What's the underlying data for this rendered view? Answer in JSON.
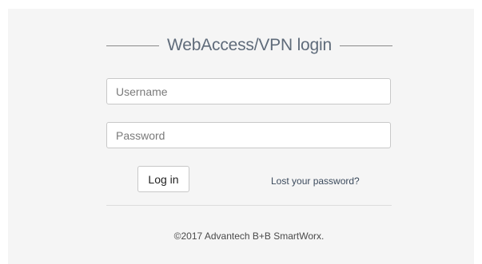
{
  "login": {
    "title": "WebAccess/VPN login",
    "username_placeholder": "Username",
    "username_value": "",
    "password_placeholder": "Password",
    "password_value": "",
    "login_button_label": "Log in",
    "lost_password_link": "Lost your password?",
    "copyright": "©2017 Advantech B+B SmartWorx."
  }
}
